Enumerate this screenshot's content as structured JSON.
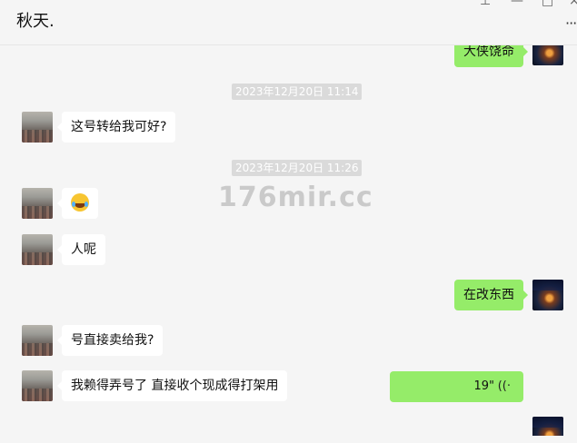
{
  "header": {
    "title": "秋天.",
    "more_icon": "more-dots-icon",
    "window_controls": [
      "pin-icon",
      "minimize-icon",
      "maximize-icon",
      "close-icon"
    ]
  },
  "watermark": "176mir.cc",
  "messages": [
    {
      "side": "right",
      "text": "大侠饶命"
    },
    {
      "type": "timestamp",
      "text": "2023年12月20日 11:14"
    },
    {
      "side": "left",
      "text": "这号转给我可好?"
    },
    {
      "type": "timestamp",
      "text": "2023年12月20日 11:26"
    },
    {
      "side": "left",
      "emoji": "laughing-tears-emoji"
    },
    {
      "side": "left",
      "text": "人呢"
    },
    {
      "side": "right",
      "text": "在改东西"
    },
    {
      "side": "left",
      "text": "号直接卖给我?"
    },
    {
      "side": "left",
      "text": "我赖得弄号了 直接收个现成得打架用"
    },
    {
      "side": "right",
      "type": "voice",
      "duration": "19\"",
      "icon": "voice-wave-icon"
    }
  ]
}
